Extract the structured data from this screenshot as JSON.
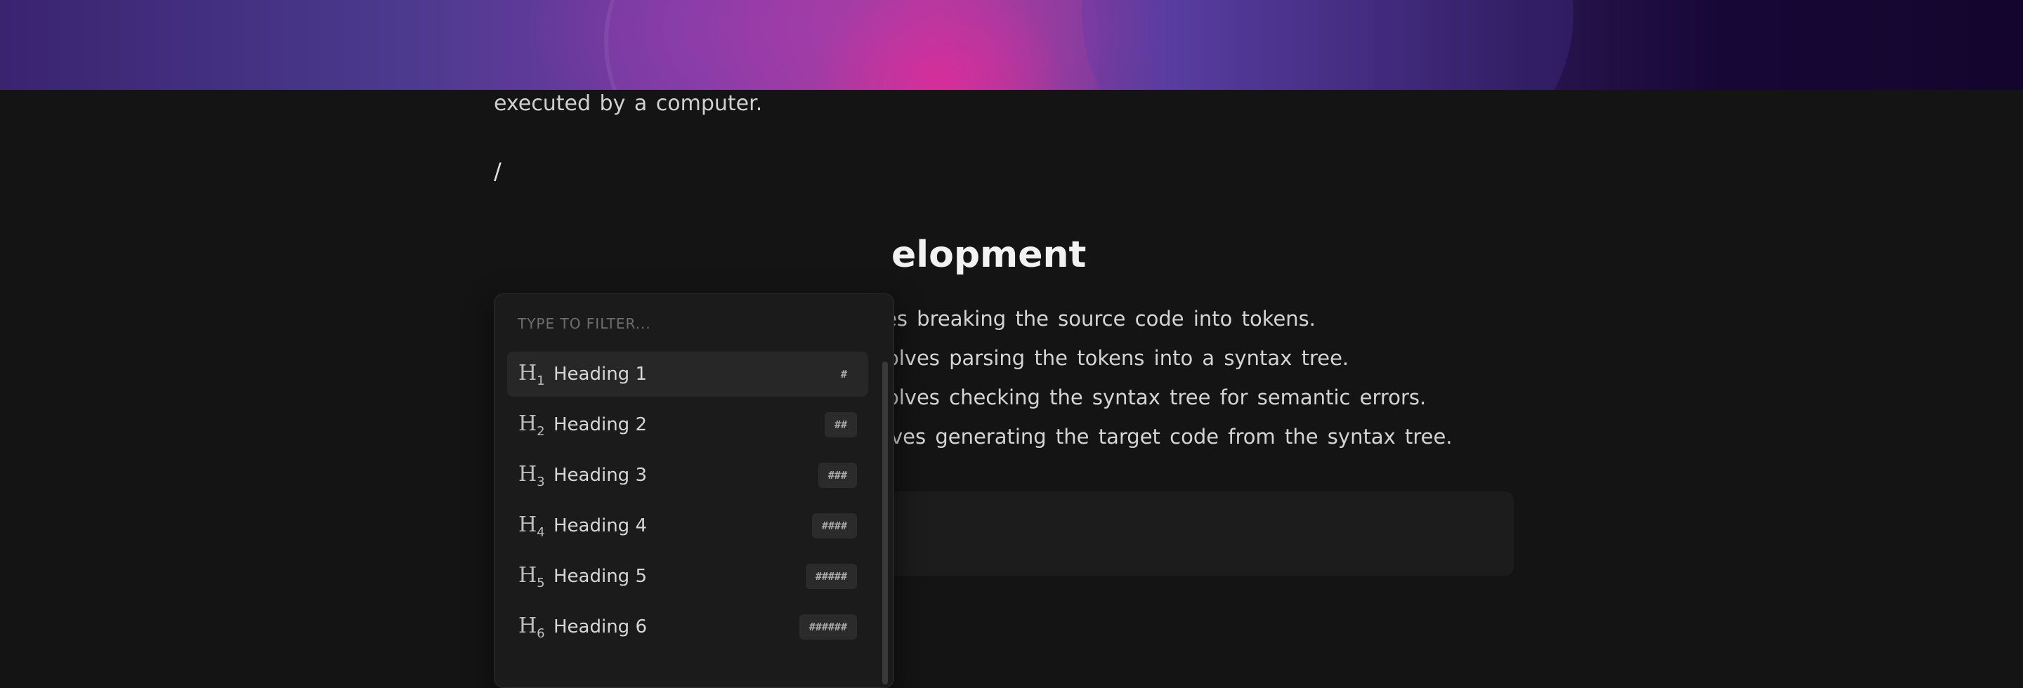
{
  "editor": {
    "paragraph_tail": "executed by a computer.",
    "slash_text": "/",
    "heading_visible": "elopment",
    "bullets": [
      "es breaking the source code into tokens.",
      "olves parsing the tokens into a syntax tree.",
      "olves checking the syntax tree for semantic errors.",
      "ves generating the target code from the syntax tree."
    ]
  },
  "slash_menu": {
    "filter_placeholder": "TYPE TO FILTER...",
    "items": [
      {
        "icon": "heading-1-icon",
        "glyph": "H",
        "sub": "1",
        "label": "Heading 1",
        "shortcut": "#",
        "active": true
      },
      {
        "icon": "heading-2-icon",
        "glyph": "H",
        "sub": "2",
        "label": "Heading 2",
        "shortcut": "##",
        "active": false
      },
      {
        "icon": "heading-3-icon",
        "glyph": "H",
        "sub": "3",
        "label": "Heading 3",
        "shortcut": "###",
        "active": false
      },
      {
        "icon": "heading-4-icon",
        "glyph": "H",
        "sub": "4",
        "label": "Heading 4",
        "shortcut": "####",
        "active": false
      },
      {
        "icon": "heading-5-icon",
        "glyph": "H",
        "sub": "5",
        "label": "Heading 5",
        "shortcut": "#####",
        "active": false
      },
      {
        "icon": "heading-6-icon",
        "glyph": "H",
        "sub": "6",
        "label": "Heading 6",
        "shortcut": "######",
        "active": false
      }
    ]
  },
  "colors": {
    "background": "#141414",
    "menu_background": "#1b1b1b",
    "banner_accent": "#e0289a"
  }
}
